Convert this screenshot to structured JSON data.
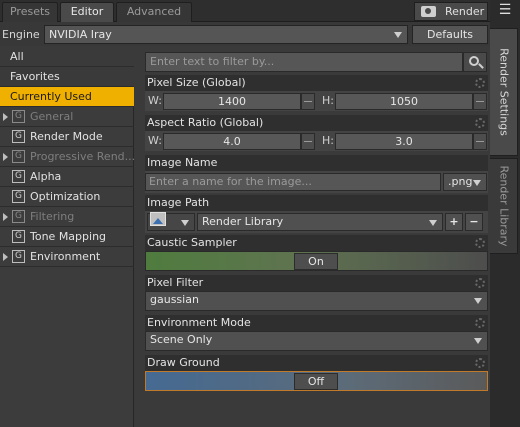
{
  "tabs": [
    "Presets",
    "Editor",
    "Advanced"
  ],
  "render_button": "Render",
  "engine": {
    "label": "Engine :",
    "value": "NVIDIA Iray",
    "defaults": "Defaults"
  },
  "left_items": [
    {
      "label": "All"
    },
    {
      "label": "Favorites"
    },
    {
      "label": "Currently Used"
    },
    {
      "label": "General"
    },
    {
      "label": "Render Mode"
    },
    {
      "label": "Progressive Rend..."
    },
    {
      "label": "Alpha"
    },
    {
      "label": "Optimization"
    },
    {
      "label": "Filtering"
    },
    {
      "label": "Tone Mapping"
    },
    {
      "label": "Environment"
    }
  ],
  "group_icon_letter": "G",
  "filter_placeholder": "Enter text to filter by...",
  "pixel_size": {
    "title": "Pixel Size (Global)",
    "w_label": "W:",
    "w_value": "1400",
    "h_label": "H:",
    "h_value": "1050"
  },
  "aspect_ratio": {
    "title": "Aspect Ratio (Global)",
    "w_label": "W:",
    "w_value": "4.0",
    "h_label": "H:",
    "h_value": "3.0"
  },
  "image_name": {
    "title": "Image Name",
    "placeholder": "Enter a name for the image...",
    "ext": ".png"
  },
  "image_path": {
    "title": "Image Path",
    "value": "Render Library",
    "add": "+",
    "remove": "−"
  },
  "caustic": {
    "title": "Caustic Sampler",
    "state": "On"
  },
  "pixel_filter": {
    "title": "Pixel Filter",
    "value": "gaussian"
  },
  "env_mode": {
    "title": "Environment Mode",
    "value": "Scene Only"
  },
  "draw_ground": {
    "title": "Draw Ground",
    "state": "Off"
  },
  "side_tabs": [
    "Render Settings",
    "Render Library"
  ]
}
